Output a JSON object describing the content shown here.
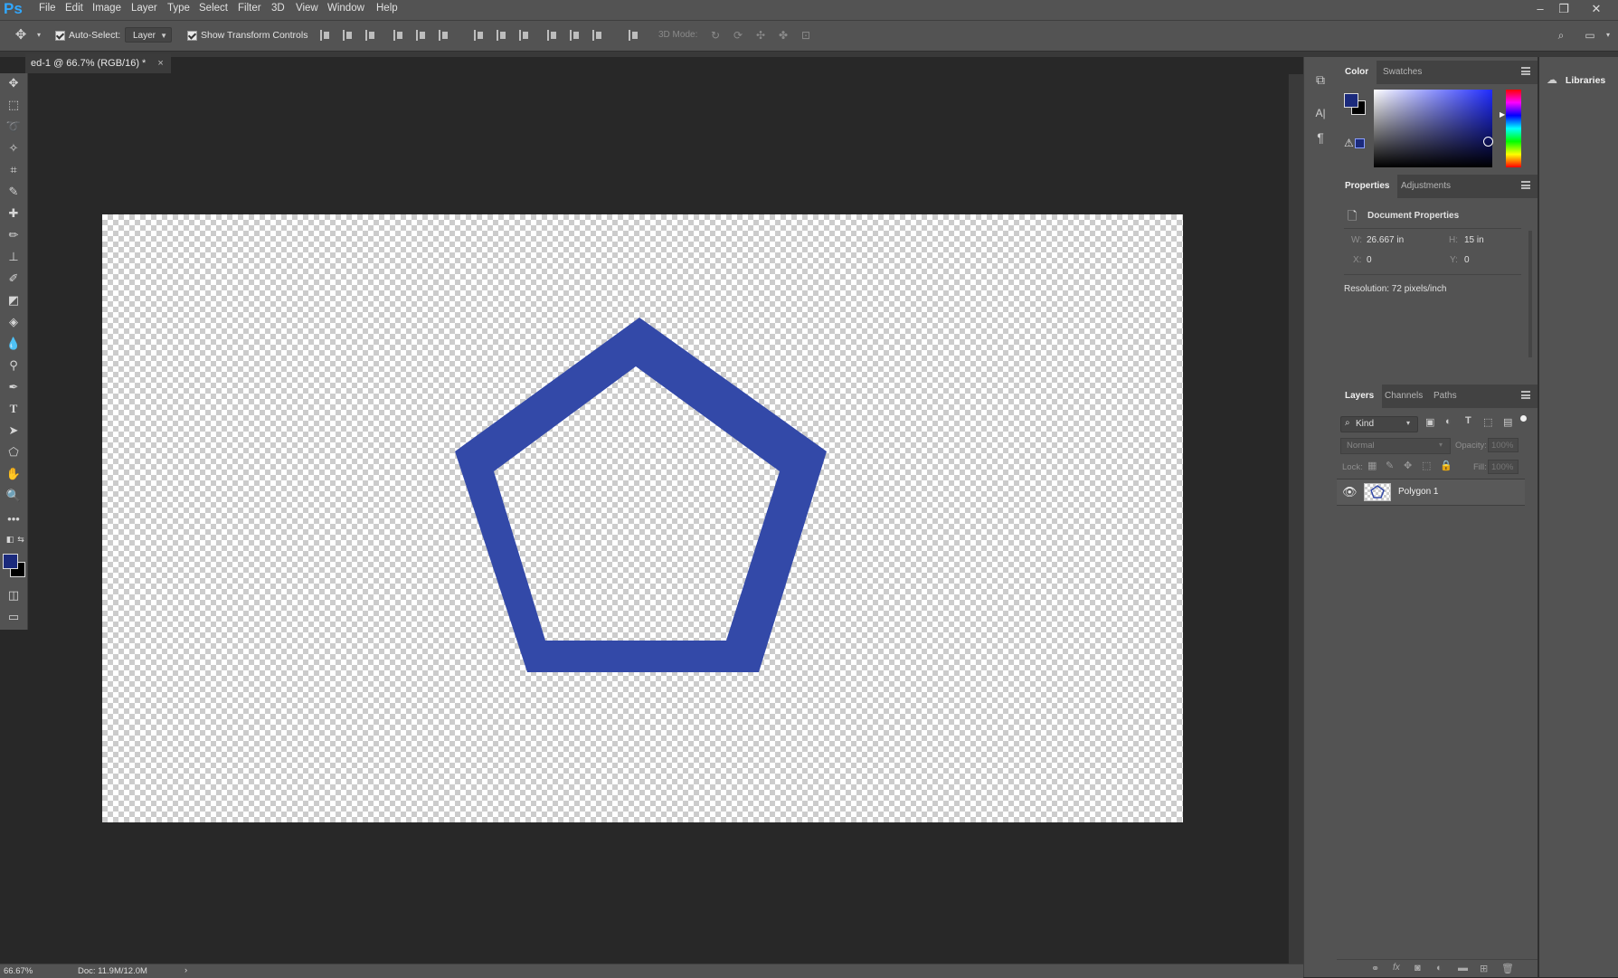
{
  "app": {
    "logo": "Ps"
  },
  "menu": [
    "File",
    "Edit",
    "Image",
    "Layer",
    "Type",
    "Select",
    "Filter",
    "3D",
    "View",
    "Window",
    "Help"
  ],
  "window_controls": [
    "–",
    "❐",
    "✕"
  ],
  "options_bar": {
    "auto_select_label": "Auto-Select:",
    "auto_select_target": "Layer",
    "show_transform_label": "Show Transform Controls",
    "mode_3d_label": "3D Mode:"
  },
  "document_tab": {
    "title": "ed-1 @ 66.7% (RGB/16) *",
    "close": "×"
  },
  "canvas": {
    "shape_fill": "#3349a8",
    "shape": "Polygon 1"
  },
  "colors": {
    "foreground": "#1b2a7c",
    "background": "#000000",
    "accent": "#31a8ff"
  },
  "color_panel": {
    "tabs": [
      "Color",
      "Swatches"
    ],
    "active_tab": "Color"
  },
  "properties_panel": {
    "tabs": [
      "Properties",
      "Adjustments"
    ],
    "title": "Document Properties",
    "w_label": "W:",
    "w_value": "26.667 in",
    "h_label": "H:",
    "h_value": "15 in",
    "x_label": "X:",
    "x_value": "0",
    "y_label": "Y:",
    "y_value": "0",
    "resolution": "Resolution: 72 pixels/inch"
  },
  "layers_panel": {
    "tabs": [
      "Layers",
      "Channels",
      "Paths"
    ],
    "kind_label": "Kind",
    "blend_mode": "Normal",
    "opacity_label": "Opacity:",
    "opacity_value": "100%",
    "lock_label": "Lock:",
    "fill_label": "Fill:",
    "fill_value": "100%",
    "layers": [
      {
        "name": "Polygon 1",
        "visible": true
      }
    ]
  },
  "libraries_label": "Libraries",
  "status": {
    "zoom": "66.67%",
    "doc": "Doc: 11.9M/12.0M",
    "arrow": "›"
  }
}
